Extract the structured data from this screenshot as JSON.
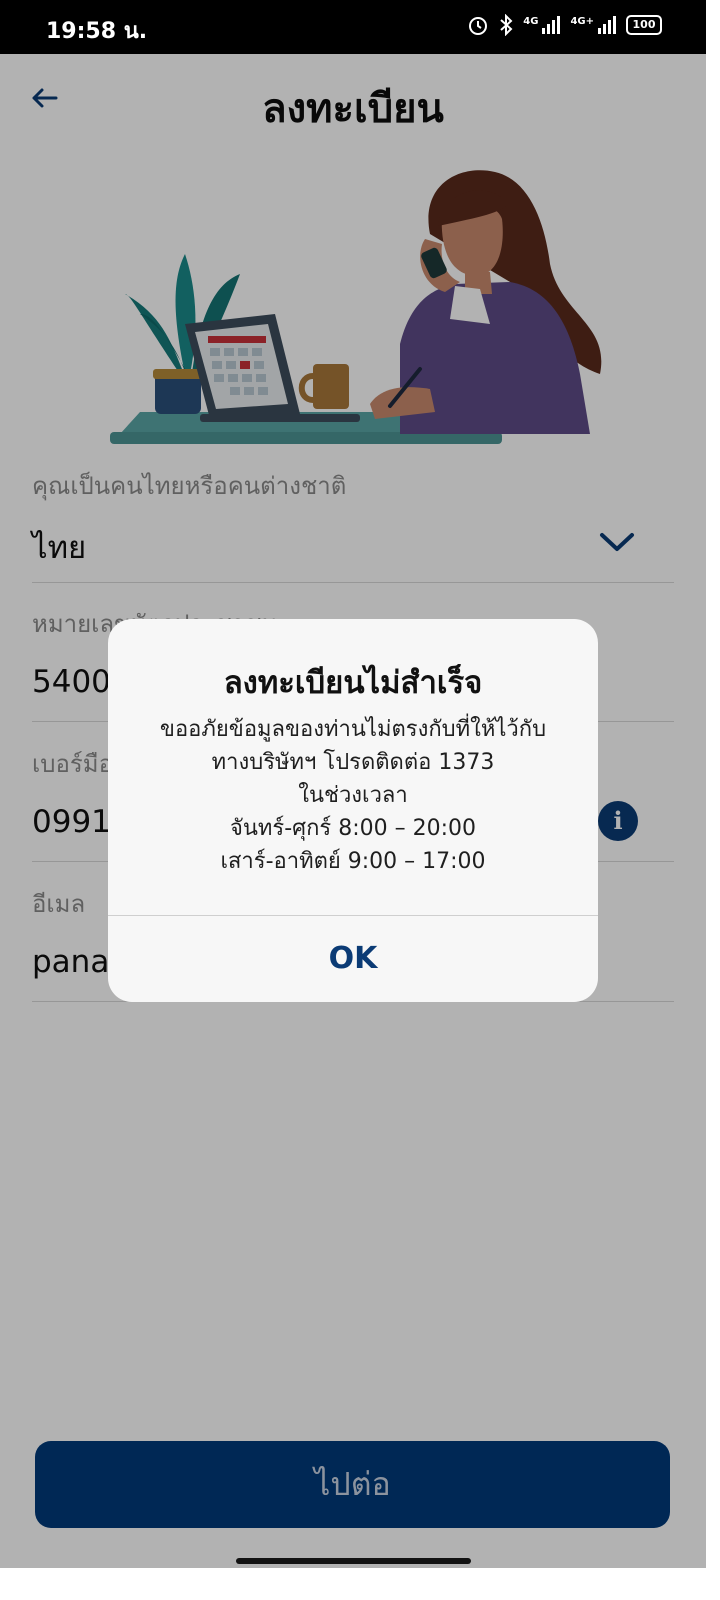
{
  "status_bar": {
    "time": "19:58 น.",
    "battery": "100",
    "network_1": "4G",
    "network_2": "4G+"
  },
  "header": {
    "title": "ลงทะเบียน",
    "back_icon": "arrow-left-icon"
  },
  "form": {
    "nationality": {
      "label": "คุณเป็นคนไทยหรือคนต่างชาติ",
      "value": "ไทย"
    },
    "id_card": {
      "label": "หมายเลขบัตรประชาชน",
      "value": "5400"
    },
    "mobile": {
      "label": "เบอร์มือถือ",
      "value": "0991"
    },
    "email": {
      "label": "อีเมล",
      "value": "panar"
    }
  },
  "continue_button": {
    "label": "ไปต่อ"
  },
  "dialog": {
    "title": "ลงทะเบียนไม่สำเร็จ",
    "lines": [
      "ขออภัยข้อมูลของท่านไม่ตรงกับที่ให้ไว้กับ",
      "ทางบริษัทฯ โปรดติดต่อ 1373",
      "ในช่วงเวลา",
      "จันทร์-ศุกร์ 8:00 – 20:00",
      "เสาร์-อาทิตย์ 9:00 – 17:00"
    ],
    "ok_label": "OK"
  },
  "colors": {
    "primary": "#003a7a",
    "accent_icon": "#0b3b75",
    "overlay": "rgba(0,0,0,0.30)"
  }
}
